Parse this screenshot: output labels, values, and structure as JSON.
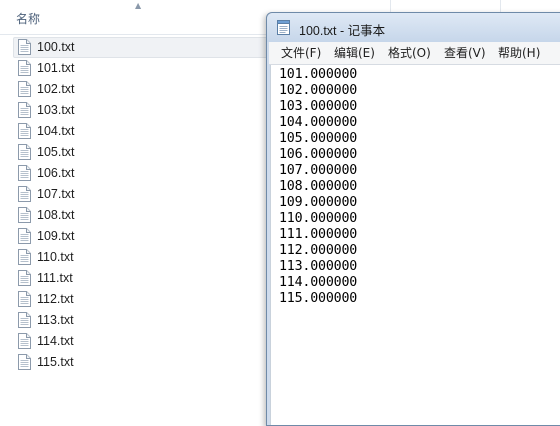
{
  "explorer": {
    "column_name": "名称",
    "files": [
      "100.txt",
      "101.txt",
      "102.txt",
      "103.txt",
      "104.txt",
      "105.txt",
      "106.txt",
      "107.txt",
      "108.txt",
      "109.txt",
      "110.txt",
      "111.txt",
      "112.txt",
      "113.txt",
      "114.txt",
      "115.txt"
    ],
    "selected_file": "100.txt"
  },
  "notepad": {
    "title": "100.txt - 记事本",
    "menu": [
      "文件(F)",
      "编辑(E)",
      "格式(O)",
      "查看(V)",
      "帮助(H)"
    ],
    "lines": [
      "101.000000",
      "102.000000",
      "103.000000",
      "104.000000",
      "105.000000",
      "106.000000",
      "107.000000",
      "108.000000",
      "109.000000",
      "110.000000",
      "111.000000",
      "112.000000",
      "113.000000",
      "114.000000",
      "115.000000"
    ]
  },
  "icons": {
    "file_icon": "text-file-icon",
    "app_icon": "notepad-icon",
    "sort_icon": "sort-up-icon"
  }
}
